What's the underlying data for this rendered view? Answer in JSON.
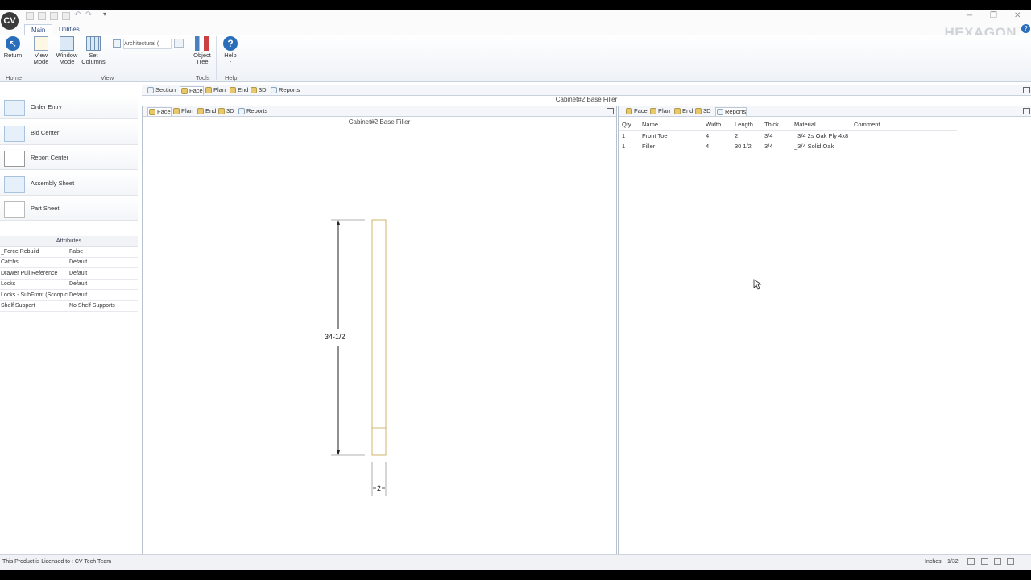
{
  "app": {
    "logo": "CV",
    "brand": "HEXAGON",
    "accent": "#2a6ebb"
  },
  "ribbon": {
    "tabs": [
      {
        "label": "Main",
        "active": true
      },
      {
        "label": "Utilities",
        "active": false
      }
    ],
    "buttons": {
      "return": "Return",
      "view_mode_1": "View",
      "view_mode_2": "Mode",
      "window_mode_1": "Window",
      "window_mode_2": "Mode",
      "set_columns_1": "Set",
      "set_columns_2": "Columns",
      "object_tree_1": "Object",
      "object_tree_2": "Tree",
      "help": "Help",
      "help_2": "-"
    },
    "dropdown_value": "Architectural (",
    "groups": {
      "home": "Home",
      "view": "View",
      "tools": "Tools",
      "help": "Help"
    }
  },
  "sidebar": {
    "items": [
      {
        "label": "Order Entry",
        "icon": "order-entry-icon"
      },
      {
        "label": "Bid Center",
        "icon": "bid-center-icon"
      },
      {
        "label": "Report Center",
        "icon": "report-center-icon"
      },
      {
        "label": "Assembly Sheet",
        "icon": "assembly-sheet-icon"
      },
      {
        "label": "Part Sheet",
        "icon": "part-sheet-icon"
      }
    ],
    "attributes_title": "Attributes",
    "attributes": [
      {
        "key": "_Force Rebuild",
        "value": "False"
      },
      {
        "key": "Catchs",
        "value": "Default"
      },
      {
        "key": "Drawer Pull Reference",
        "value": "Default"
      },
      {
        "key": "Locks",
        "value": "Default"
      },
      {
        "key": "Locks - SubFront (Scoop c",
        "value": "Default"
      },
      {
        "key": "Shelf Support",
        "value": "No Shelf Supports"
      }
    ]
  },
  "main": {
    "top_tabs": [
      "Section",
      "Face",
      "Plan",
      "End",
      "3D",
      "Reports"
    ],
    "top_active": "Face",
    "title": "Cabinet#2 Base Filler",
    "left_view": {
      "tabs": [
        "Face",
        "Plan",
        "End",
        "3D",
        "Reports"
      ],
      "active": "Face",
      "title": "Cabinet#2 Base Filler",
      "dim_height": "34-1/2",
      "dim_width": "2"
    },
    "right_view": {
      "tabs": [
        "Face",
        "Plan",
        "End",
        "3D",
        "Reports"
      ],
      "active": "Reports",
      "columns": [
        "Qty",
        "Name",
        "Width",
        "Length",
        "Thick",
        "Material",
        "Comment"
      ],
      "rows": [
        [
          "1",
          "Front Toe",
          "4",
          "2",
          "3/4",
          "_3/4 2s Oak Ply 4x8",
          ""
        ],
        [
          "1",
          "Filler",
          "4",
          "30 1/2",
          "3/4",
          "_3/4 Solid Oak",
          ""
        ]
      ]
    }
  },
  "statusbar": {
    "license": "This Product is Licensed to : CV Tech Team",
    "units": "Inches",
    "precision": "1/32"
  }
}
